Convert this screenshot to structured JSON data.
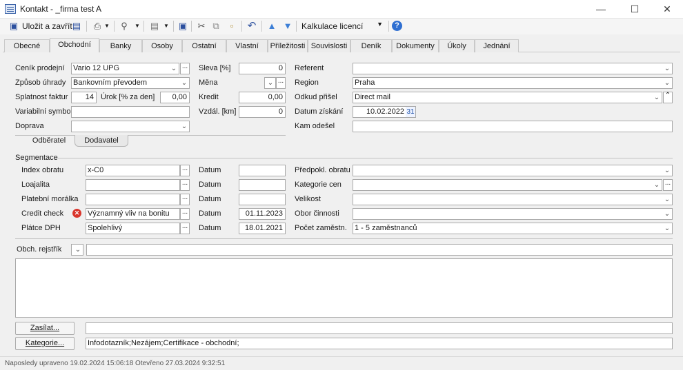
{
  "window": {
    "title": "Kontakt - _firma test A",
    "minimize": "—",
    "maximize": "☐",
    "close": "✕"
  },
  "toolbar": {
    "save_close": "Uložit a zavřít",
    "combo_value": "Kalkulace licencí"
  },
  "tabs": [
    "Obecné",
    "Obchodní",
    "Banky",
    "Osoby",
    "Ostatní",
    "Vlastní",
    "Příležitosti",
    "Souvislosti",
    "Deník",
    "Dokumenty",
    "Úkoly",
    "Jednání"
  ],
  "top": {
    "cenik_label": "Ceník prodejní",
    "cenik_value": "Vario 12 UPG",
    "zpusob_label": "Způsob úhrady",
    "zpusob_value": "Bankovním převodem",
    "splatnost_label": "Splatnost faktur",
    "splatnost_value": "14",
    "urok_label": "Úrok [% za den]",
    "urok_value": "0,00",
    "varsym_label": "Variabilní symbol",
    "varsym_value": "",
    "doprava_label": "Doprava",
    "doprava_value": "",
    "sleva_label": "Sleva [%]",
    "sleva_value": "0",
    "mena_label": "Měna",
    "mena_value": "",
    "kredit_label": "Kredit",
    "kredit_value": "0,00",
    "vzdal_label": "Vzdál. [km]",
    "vzdal_value": "0",
    "referent_label": "Referent",
    "referent_value": "",
    "region_label": "Region",
    "region_value": "Praha",
    "odkud_label": "Odkud přišel",
    "odkud_value": "Direct mail",
    "datum_ziskani_label": "Datum získání",
    "datum_ziskani_value": "10.02.2022",
    "cal_label": "31",
    "kam_label": "Kam odešel",
    "kam_value": ""
  },
  "subtabs": [
    "Odběratel",
    "Dodavatel"
  ],
  "segmentace": {
    "title": "Segmentace",
    "index_label": "Index obratu",
    "index_value": "x-C0",
    "loajalita_label": "Loajalita",
    "loajalita_value": "",
    "moralka_label": "Platební morálka",
    "moralka_value": "",
    "credit_label": "Credit check",
    "credit_value": "Významný vliv na bonitu",
    "platce_label": "Plátce DPH",
    "platce_value": "Spolehlivý",
    "datum_label": "Datum",
    "datum1": "",
    "datum2": "",
    "datum3": "",
    "datum4": "01.11.2023",
    "datum5": "18.01.2021",
    "predpokl_label": "Předpokl. obratu",
    "predpokl_value": "",
    "kategorie_cen_label": "Kategorie cen",
    "kategorie_cen_value": "",
    "velikost_label": "Velikost",
    "velikost_value": "",
    "obor_label": "Obor činnosti",
    "obor_value": "",
    "pocet_label": "Počet zaměstn.",
    "pocet_value": "1 - 5 zaměstnanců"
  },
  "rejstrik": {
    "label": "Obch. rejstřík",
    "value": ""
  },
  "bottom": {
    "zasilat_button": "Zasílat...",
    "zasilat_value": "",
    "kategorie_button": "Kategorie...",
    "kategorie_value": "Infodotazník;Nezájem;Certifikace - obchodní;"
  },
  "status": "Naposledy upraveno 19.02.2024 15:06:18 Otevřeno 27.03.2024 9:32:51"
}
